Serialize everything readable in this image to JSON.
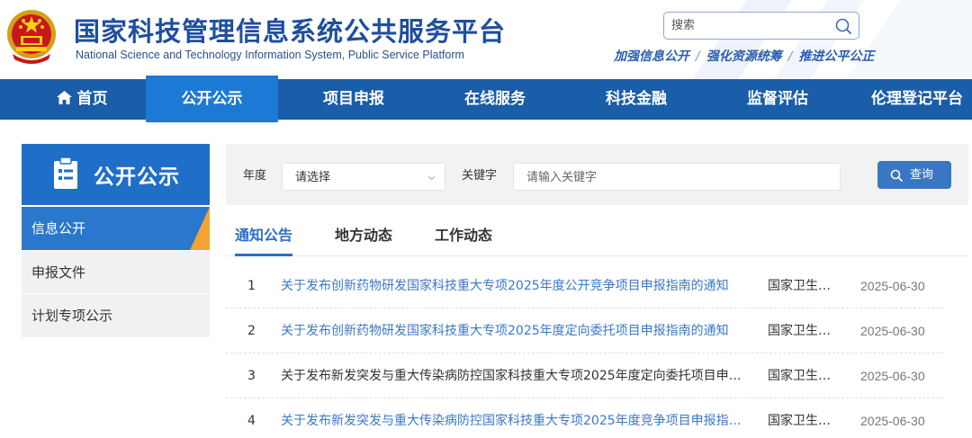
{
  "header": {
    "title": "国家科技管理信息系统公共服务平台",
    "subtitle": "National Science and Technology Information System, Public Service Platform",
    "search_placeholder": "搜索",
    "slogan": [
      "加强信息公开",
      "强化资源统筹",
      "推进公平公正"
    ],
    "slogan_sep": "/"
  },
  "nav": {
    "items": [
      {
        "label": "首页",
        "icon": "home-icon"
      },
      {
        "label": "公开公示",
        "active": true
      },
      {
        "label": "项目申报"
      },
      {
        "label": "在线服务"
      },
      {
        "label": "科技金融"
      },
      {
        "label": "监督评估"
      },
      {
        "label": "伦理登记平台"
      }
    ]
  },
  "sidebar": {
    "title": "公开公示",
    "title_icon": "document-icon",
    "items": [
      {
        "label": "信息公开",
        "active": true
      },
      {
        "label": "申报文件"
      },
      {
        "label": "计划专项公示"
      }
    ]
  },
  "filters": {
    "year_label": "年度",
    "year_value": "请选择",
    "keyword_label": "关键字",
    "keyword_placeholder": "请输入关键字",
    "query_label": "查询"
  },
  "tabs": [
    {
      "label": "通知公告",
      "active": true
    },
    {
      "label": "地方动态"
    },
    {
      "label": "工作动态"
    }
  ],
  "notices": [
    {
      "index": "1",
      "title": "关于发布创新药物研发国家科技重大专项2025年度公开竞争项目申报指南的通知",
      "source": "国家卫生健康委员会",
      "date": "2025-06-30",
      "link": true
    },
    {
      "index": "2",
      "title": "关于发布创新药物研发国家科技重大专项2025年度定向委托项目申报指南的通知",
      "source": "国家卫生健康委员会",
      "date": "2025-06-30",
      "link": true
    },
    {
      "index": "3",
      "title": "关于发布新发突发与重大传染病防控国家科技重大专项2025年度定向委托项目申报指南的通知",
      "source": "国家卫生健康委员会",
      "date": "2025-06-30",
      "link": false
    },
    {
      "index": "4",
      "title": "关于发布新发突发与重大传染病防控国家科技重大专项2025年度竞争项目申报指南的通知",
      "source": "国家卫生健康委员会",
      "date": "2025-06-30",
      "link": true
    }
  ],
  "colors": {
    "nav_bg": "#1a5da8",
    "nav_active": "#1c7ad6",
    "link": "#3b78c9",
    "accent_orange": "#f3a233",
    "title_blue": "#1f4e9e"
  }
}
